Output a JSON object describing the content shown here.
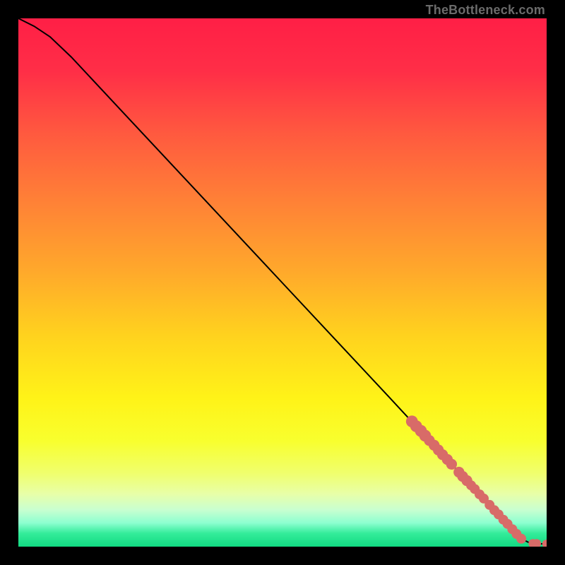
{
  "watermark": "TheBottleneck.com",
  "chart_data": {
    "type": "line",
    "title": "",
    "xlabel": "",
    "ylabel": "",
    "xlim": [
      0,
      100
    ],
    "ylim": [
      0,
      100
    ],
    "grid": false,
    "series": [
      {
        "name": "curve",
        "x": [
          0,
          3,
          6,
          10,
          20,
          30,
          40,
          50,
          60,
          70,
          75,
          80,
          85,
          88,
          90,
          93,
          95,
          97,
          100
        ],
        "y": [
          100,
          98.5,
          96.5,
          92.7,
          82,
          71.3,
          60.6,
          49.9,
          39.2,
          28.5,
          23.1,
          17.8,
          12.4,
          9.2,
          7,
          3.8,
          1.6,
          0.6,
          0.5
        ]
      }
    ],
    "markers": [
      {
        "x": 74.5,
        "y": 23.7,
        "r": 1.2
      },
      {
        "x": 75.3,
        "y": 22.8,
        "r": 1.2
      },
      {
        "x": 76.2,
        "y": 21.9,
        "r": 1.2
      },
      {
        "x": 77.0,
        "y": 21.0,
        "r": 1.2
      },
      {
        "x": 77.8,
        "y": 20.1,
        "r": 1.1
      },
      {
        "x": 78.7,
        "y": 19.2,
        "r": 1.1
      },
      {
        "x": 79.5,
        "y": 18.3,
        "r": 1.1
      },
      {
        "x": 80.3,
        "y": 17.4,
        "r": 1.1
      },
      {
        "x": 81.2,
        "y": 16.5,
        "r": 1.1
      },
      {
        "x": 82.0,
        "y": 15.6,
        "r": 1.1
      },
      {
        "x": 83.4,
        "y": 14.1,
        "r": 1.1
      },
      {
        "x": 84.1,
        "y": 13.3,
        "r": 1.1
      },
      {
        "x": 84.9,
        "y": 12.5,
        "r": 1.1
      },
      {
        "x": 85.7,
        "y": 11.6,
        "r": 1.0
      },
      {
        "x": 86.4,
        "y": 10.9,
        "r": 1.0
      },
      {
        "x": 87.3,
        "y": 9.9,
        "r": 1.0
      },
      {
        "x": 88.1,
        "y": 9.1,
        "r": 1.0
      },
      {
        "x": 89.2,
        "y": 7.9,
        "r": 1.0
      },
      {
        "x": 90.1,
        "y": 6.9,
        "r": 1.0
      },
      {
        "x": 90.9,
        "y": 6.1,
        "r": 1.0
      },
      {
        "x": 91.8,
        "y": 5.1,
        "r": 1.0
      },
      {
        "x": 92.6,
        "y": 4.3,
        "r": 1.0
      },
      {
        "x": 93.5,
        "y": 3.3,
        "r": 1.0
      },
      {
        "x": 94.3,
        "y": 2.4,
        "r": 1.0
      },
      {
        "x": 95.2,
        "y": 1.5,
        "r": 1.0
      },
      {
        "x": 97.4,
        "y": 0.6,
        "r": 0.9
      },
      {
        "x": 98.1,
        "y": 0.6,
        "r": 0.9
      },
      {
        "x": 100.0,
        "y": 0.5,
        "r": 0.9
      }
    ],
    "background_gradient": {
      "stops": [
        {
          "pos": 0.0,
          "color": "#ff1f46"
        },
        {
          "pos": 0.1,
          "color": "#ff2e47"
        },
        {
          "pos": 0.22,
          "color": "#ff5a3f"
        },
        {
          "pos": 0.35,
          "color": "#ff8236"
        },
        {
          "pos": 0.48,
          "color": "#ffa92b"
        },
        {
          "pos": 0.6,
          "color": "#ffd21e"
        },
        {
          "pos": 0.72,
          "color": "#fff318"
        },
        {
          "pos": 0.8,
          "color": "#f8ff2e"
        },
        {
          "pos": 0.86,
          "color": "#f0ff6c"
        },
        {
          "pos": 0.9,
          "color": "#e8ffa8"
        },
        {
          "pos": 0.93,
          "color": "#c9ffd0"
        },
        {
          "pos": 0.955,
          "color": "#8dffd0"
        },
        {
          "pos": 0.975,
          "color": "#33ec9a"
        },
        {
          "pos": 1.0,
          "color": "#12da82"
        }
      ]
    },
    "marker_color": "#d86b68",
    "curve_color": "#000000"
  }
}
